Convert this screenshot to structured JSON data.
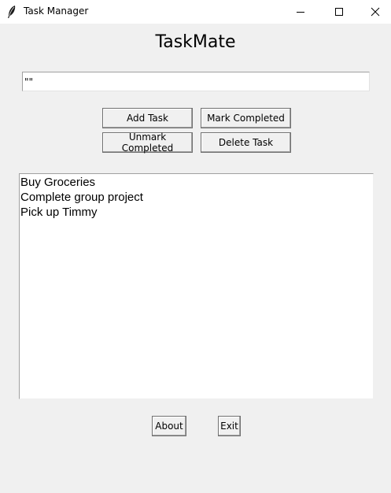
{
  "window": {
    "title": "Task Manager",
    "icon": "feather-icon",
    "controls": [
      "minimize-icon",
      "maximize-icon",
      "close-icon"
    ]
  },
  "heading": "TaskMate",
  "entry": {
    "value": "\"\""
  },
  "buttons": {
    "add": "Add Task",
    "mark": "Mark Completed",
    "unmark": "Unmark Completed",
    "delete": "Delete Task",
    "about": "About",
    "exit": "Exit"
  },
  "tasks": [
    "Buy Groceries",
    "Complete group project",
    "Pick up Timmy"
  ]
}
